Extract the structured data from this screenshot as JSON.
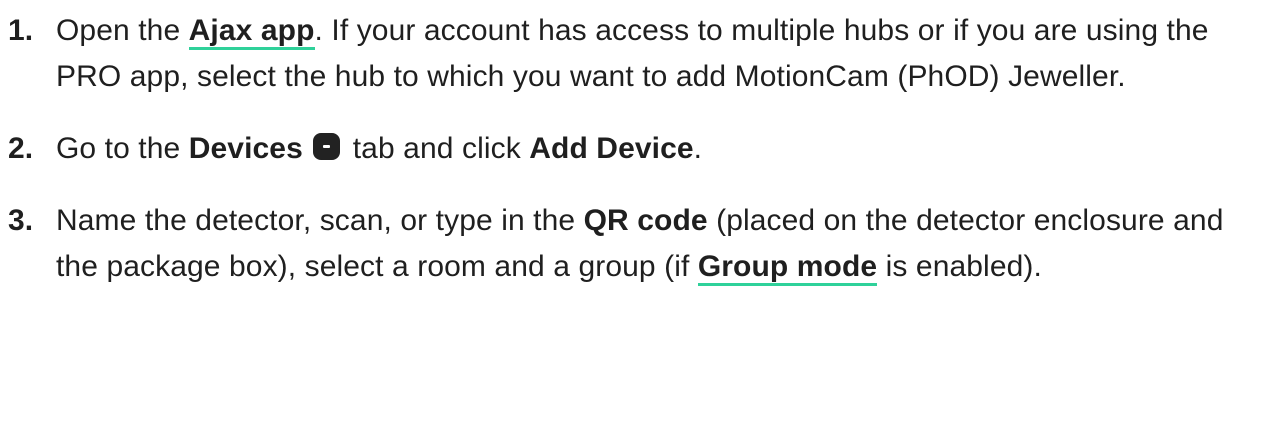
{
  "steps": [
    {
      "number": "1.",
      "t1": "Open the ",
      "link1": "Ajax app",
      "t2": ". If your account has access to multiple hubs or if you are using the PRO app, select the hub to which you want to add MotionCam (PhOD) Jeweller."
    },
    {
      "number": "2.",
      "t1": "Go to the ",
      "bold1": "Devices",
      "icon": "devices-tab-icon",
      "t2": " tab and click ",
      "bold2": "Add Device",
      "t3": "."
    },
    {
      "number": "3.",
      "t1": "Name the detector, scan, or type in the ",
      "bold1": "QR code",
      "t2": " (placed on the detector enclosure and the package box), select a room and a group (if ",
      "link1": "Group mode",
      "t3": " is enabled)."
    }
  ],
  "colors": {
    "text": "#1f1f1f",
    "link_underline": "#2fd19a",
    "icon": "#222222"
  }
}
